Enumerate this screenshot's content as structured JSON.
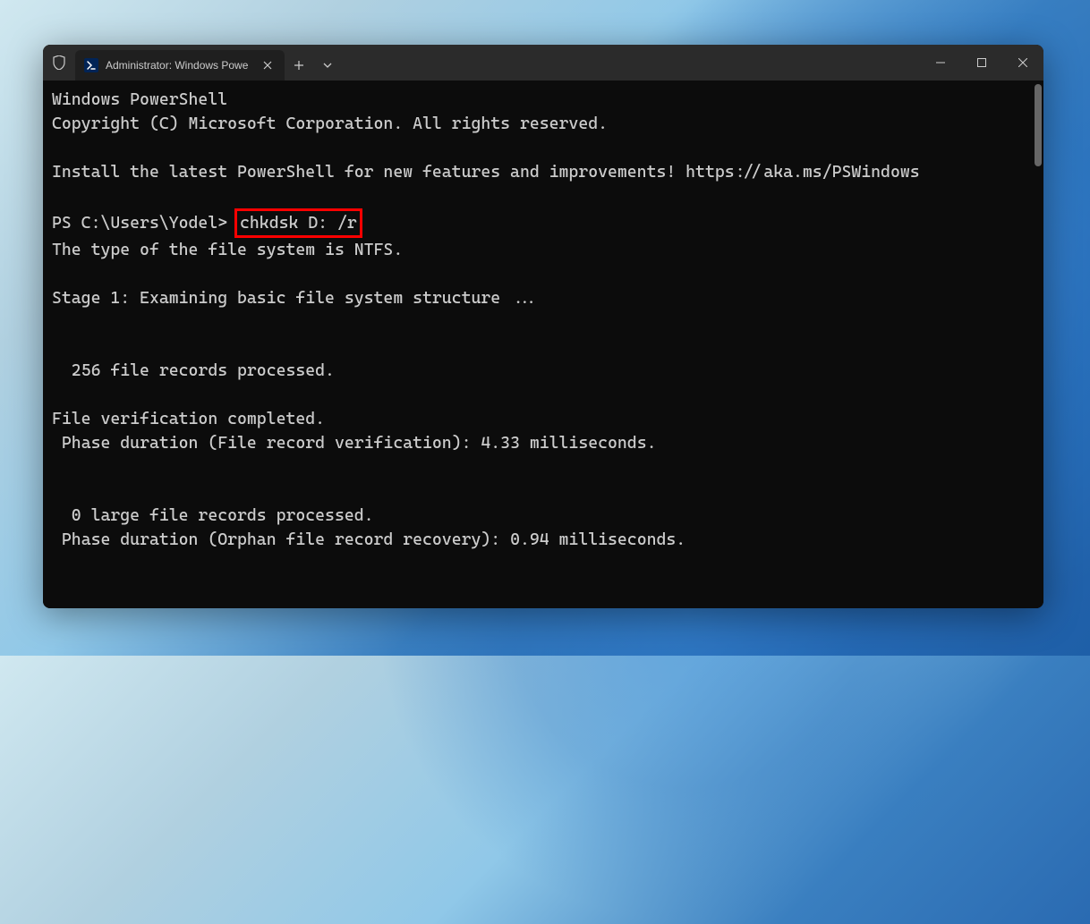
{
  "tab": {
    "title": "Administrator: Windows Powe"
  },
  "terminal": {
    "line1": "Windows PowerShell",
    "line2": "Copyright (C) Microsoft Corporation. All rights reserved.",
    "blank1": " ",
    "line3": "Install the latest PowerShell for new features and improvements! https://aka.ms/PSWindows",
    "blank2": " ",
    "prompt": "PS C:\\Users\\Yodel> ",
    "command": "chkdsk D: /r",
    "line4": "The type of the file system is NTFS.",
    "blank3": " ",
    "line5": "Stage 1: Examining basic file system structure ...",
    "blank4": " ",
    "blank5": " ",
    "line6": "  256 file records processed.",
    "blank6": " ",
    "line7": "File verification completed.",
    "line8": " Phase duration (File record verification): 4.33 milliseconds.",
    "blank7": " ",
    "blank8": " ",
    "line9": "  0 large file records processed.",
    "line10": " Phase duration (Orphan file record recovery): 0.94 milliseconds."
  }
}
